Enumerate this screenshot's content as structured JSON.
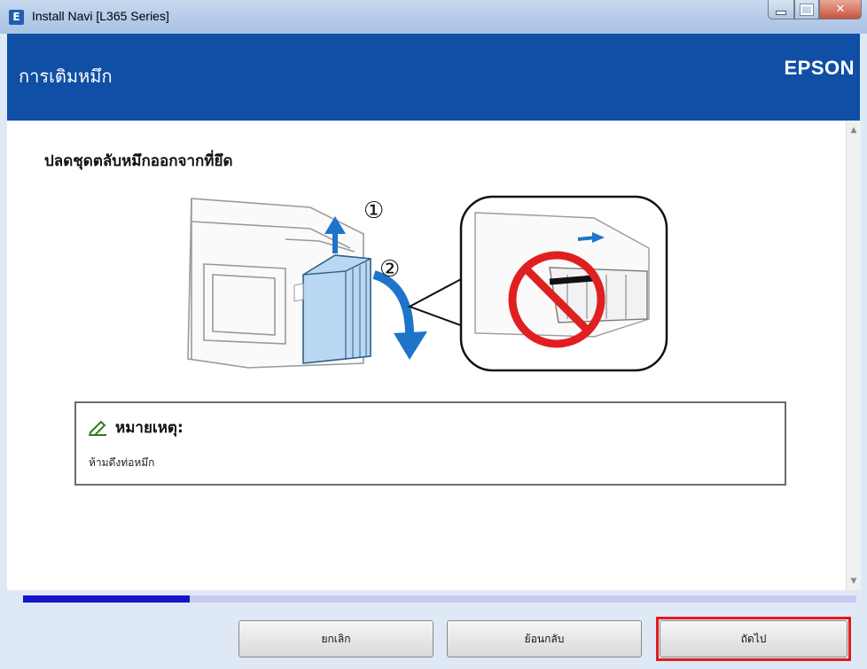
{
  "window": {
    "title": "Install Navi [L365 Series]",
    "icon": "epson-app-icon"
  },
  "header": {
    "title": "การเติมหมึก",
    "brand": "EPSON"
  },
  "main": {
    "heading": "ปลดชุดตลับหมึกออกจากที่ยึด",
    "step_labels": [
      "①",
      "②"
    ],
    "note": {
      "title": "หมายเหตุ:",
      "text": "ห้ามดึงท่อหมึก"
    }
  },
  "progress": {
    "value": 0.2
  },
  "buttons": {
    "cancel": "ยกเลิก",
    "back": "ย้อนกลับ",
    "next": "ถัดไป"
  },
  "colors": {
    "header_bg": "#0f4fa6",
    "progress_fill": "#1515c8",
    "progress_track": "#c9c9f0",
    "highlight": "#e01b1b",
    "tank_blue": "#b9d7f3",
    "prohibit_red": "#e02020"
  }
}
